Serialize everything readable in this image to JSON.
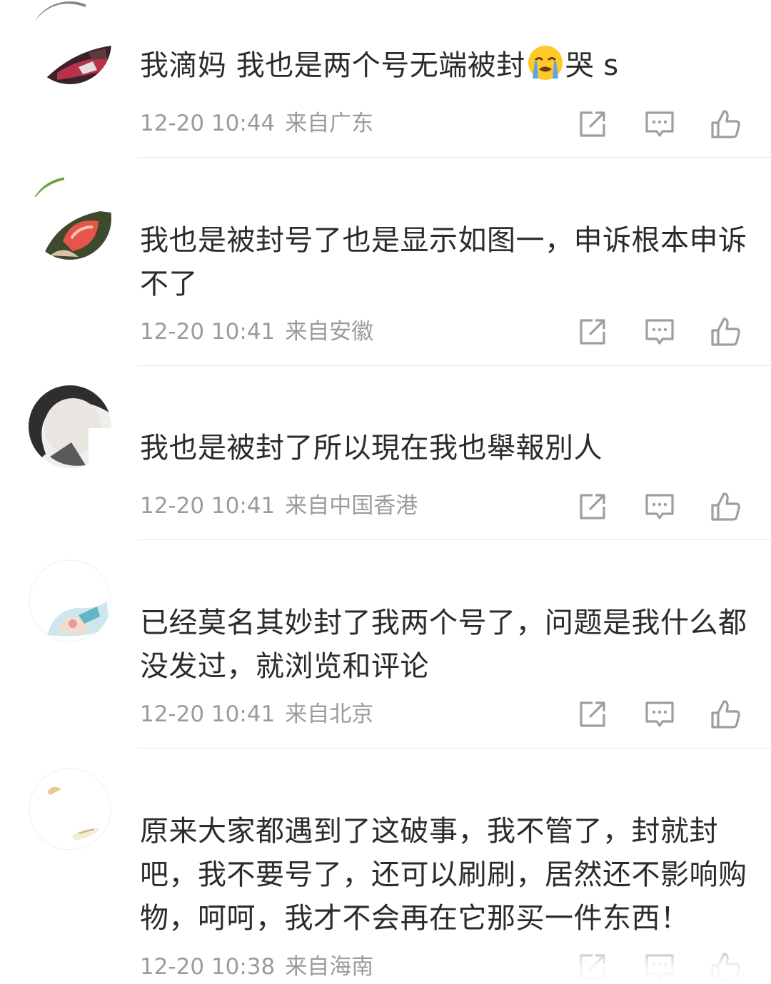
{
  "comments": [
    {
      "username": "",
      "text_before": "我滴妈 我也是两个号无端被封",
      "emoji": "loudly-crying-face",
      "text_after": "哭 s",
      "date": "12-20 10:44",
      "location": "来自广东"
    },
    {
      "username": "",
      "text": "我也是被封号了也是显示如图一，申诉根本申诉不了",
      "date": "12-20 10:41",
      "location": "来自安徽"
    },
    {
      "username": "",
      "text": "我也是被封了所以現在我也舉報別人",
      "date": "12-20 10:41",
      "location": "来自中国香港"
    },
    {
      "username": "",
      "text": "已经莫名其妙封了我两个号了，问题是我什么都没发过，就浏览和评论",
      "date": "12-20 10:41",
      "location": "来自北京"
    },
    {
      "username": "",
      "text": "原来大家都遇到了这破事，我不管了，封就封吧，我不要号了，还可以刷刷，居然还不影响购物，呵呵，我才不会再在它那买一件东西！",
      "date": "12-20 10:38",
      "location": "来自海南"
    }
  ],
  "icons": {
    "share": "share-icon",
    "comment": "comment-icon",
    "like": "thumbs-up-icon"
  },
  "colors": {
    "text": "#2b2b2b",
    "meta": "#9b9b9b",
    "icon": "#9e9e9e",
    "divider": "#e6e6e6"
  }
}
